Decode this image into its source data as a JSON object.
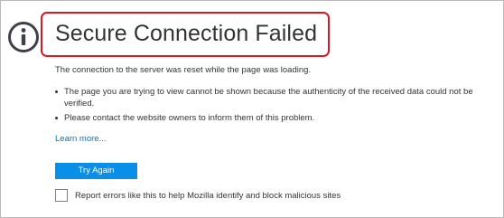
{
  "error_page": {
    "title": "Secure Connection Failed",
    "intro": "The connection to the server was reset while the page was loading.",
    "bullets": [
      "The page you are trying to view cannot be shown because the authenticity of the received data could not be verified.",
      "Please contact the website owners to inform them of this problem."
    ],
    "learn_more": "Learn more...",
    "try_again_label": "Try Again",
    "report_checkbox_label": "Report errors like this to help Mozilla identify and block malicious sites",
    "report_checkbox_checked": false
  },
  "icons": {
    "info": "info-icon"
  },
  "colors": {
    "highlight": "#e0161c",
    "link": "#0074c8",
    "button": "#0a8fe8",
    "icon": "#3d4249"
  }
}
